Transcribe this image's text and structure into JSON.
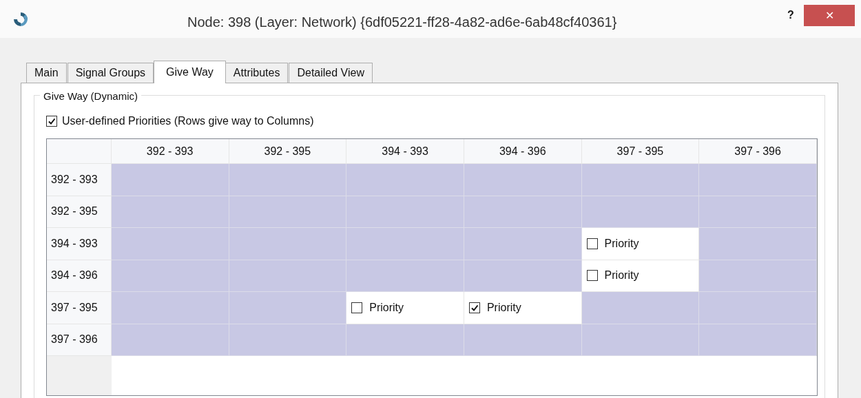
{
  "window": {
    "title": "Node: 398 (Layer: Network) {6df05221-ff28-4a82-ad6e-6ab48cf40361}",
    "help": "?",
    "close": "✕"
  },
  "tabs": [
    {
      "label": "Main",
      "selected": false
    },
    {
      "label": "Signal Groups",
      "selected": false
    },
    {
      "label": "Give Way",
      "selected": true
    },
    {
      "label": "Attributes",
      "selected": false
    },
    {
      "label": "Detailed View",
      "selected": false
    }
  ],
  "group": {
    "title": "Give Way (Dynamic)",
    "user_defined": {
      "label": "User-defined Priorities (Rows give way to Columns)",
      "checked": true
    }
  },
  "grid": {
    "columns": [
      "392 - 393",
      "392 - 395",
      "394 - 393",
      "394 - 396",
      "397 - 395",
      "397 - 396"
    ],
    "rows": [
      {
        "label": "392 - 393",
        "cells": [
          {
            "kind": "blocked"
          },
          {
            "kind": "blocked"
          },
          {
            "kind": "blocked"
          },
          {
            "kind": "blocked"
          },
          {
            "kind": "blocked"
          },
          {
            "kind": "blocked"
          }
        ]
      },
      {
        "label": "392 - 395",
        "cells": [
          {
            "kind": "blocked"
          },
          {
            "kind": "blocked"
          },
          {
            "kind": "blocked"
          },
          {
            "kind": "blocked"
          },
          {
            "kind": "blocked"
          },
          {
            "kind": "blocked"
          }
        ]
      },
      {
        "label": "394 - 393",
        "cells": [
          {
            "kind": "blocked"
          },
          {
            "kind": "blocked"
          },
          {
            "kind": "blocked"
          },
          {
            "kind": "blocked"
          },
          {
            "kind": "priority",
            "label": "Priority",
            "checked": false
          },
          {
            "kind": "blocked"
          }
        ]
      },
      {
        "label": "394 - 396",
        "cells": [
          {
            "kind": "blocked"
          },
          {
            "kind": "blocked"
          },
          {
            "kind": "blocked"
          },
          {
            "kind": "blocked"
          },
          {
            "kind": "priority",
            "label": "Priority",
            "checked": false
          },
          {
            "kind": "blocked"
          }
        ]
      },
      {
        "label": "397 - 395",
        "cells": [
          {
            "kind": "blocked"
          },
          {
            "kind": "blocked"
          },
          {
            "kind": "priority",
            "label": "Priority",
            "checked": false
          },
          {
            "kind": "priority",
            "label": "Priority",
            "checked": true
          },
          {
            "kind": "blocked"
          },
          {
            "kind": "blocked"
          }
        ]
      },
      {
        "label": "397 - 396",
        "cells": [
          {
            "kind": "blocked"
          },
          {
            "kind": "blocked"
          },
          {
            "kind": "blocked"
          },
          {
            "kind": "blocked"
          },
          {
            "kind": "blocked"
          },
          {
            "kind": "blocked"
          }
        ]
      }
    ]
  }
}
